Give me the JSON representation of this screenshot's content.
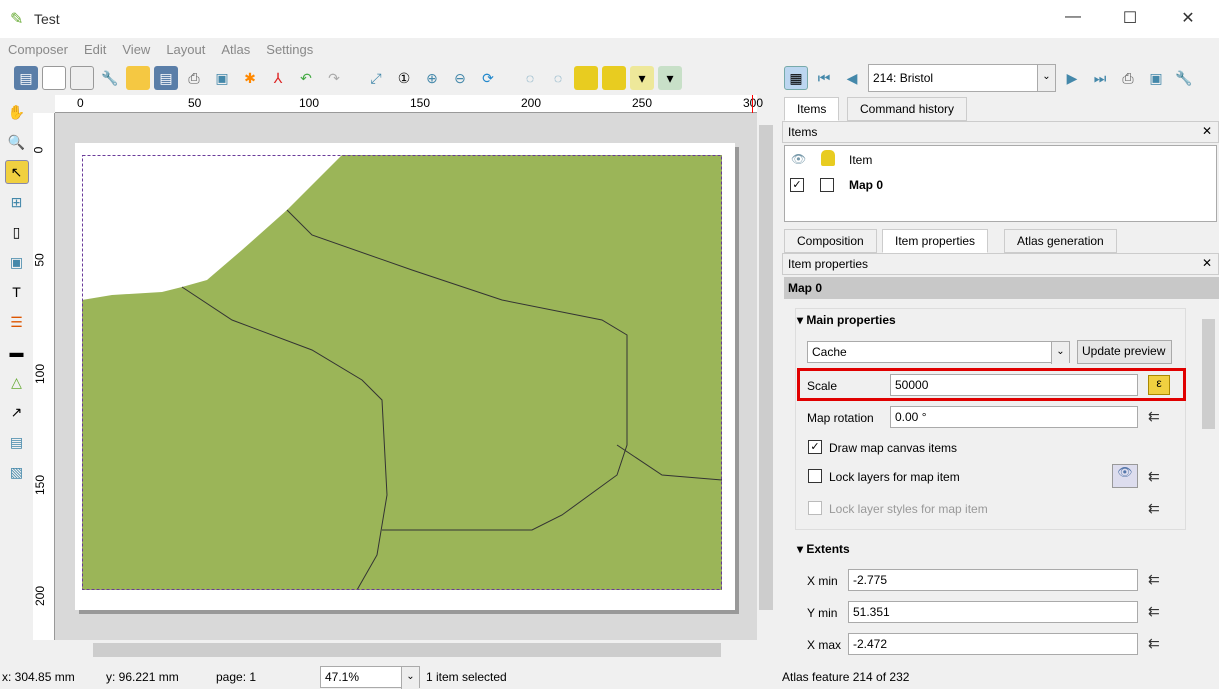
{
  "window": {
    "title": "Test"
  },
  "menu": [
    "Composer",
    "Edit",
    "View",
    "Layout",
    "Atlas",
    "Settings"
  ],
  "ruler": {
    "h_ticks": [
      "0",
      "50",
      "100",
      "150",
      "200",
      "250",
      "300"
    ],
    "v_ticks": [
      "0",
      "50",
      "100",
      "150",
      "200"
    ]
  },
  "atlas": {
    "feature": "214: Bristol"
  },
  "tabs_top": [
    "Items",
    "Command history"
  ],
  "items_panel": {
    "title": "Items",
    "col_item": "Item",
    "rows": [
      {
        "name": "Map 0",
        "visible": true,
        "locked": false
      }
    ]
  },
  "tabs_bottom": [
    "Composition",
    "Item properties",
    "Atlas generation"
  ],
  "props": {
    "title": "Item properties",
    "item": "Map 0",
    "main_section": "Main properties",
    "cache_mode": "Cache",
    "update_preview": "Update preview",
    "scale_label": "Scale",
    "scale_value": "50000",
    "rotation_label": "Map rotation",
    "rotation_value": "0.00 °",
    "draw_canvas": "Draw map canvas items",
    "lock_layers": "Lock layers for map item",
    "lock_styles": "Lock layer styles for map item",
    "extents_section": "Extents",
    "xmin_label": "X min",
    "xmin": "-2.775",
    "ymin_label": "Y min",
    "ymin": "51.351",
    "xmax_label": "X max",
    "xmax": "-2.472"
  },
  "status": {
    "x": "x: 304.85 mm",
    "y": "y: 96.221 mm",
    "page": "page: 1",
    "zoom": "47.1%",
    "selection": "1 item selected",
    "atlas": "Atlas feature 214 of 232"
  },
  "colors": {
    "map_fill": "#9bb558",
    "highlight": "#e00000"
  }
}
